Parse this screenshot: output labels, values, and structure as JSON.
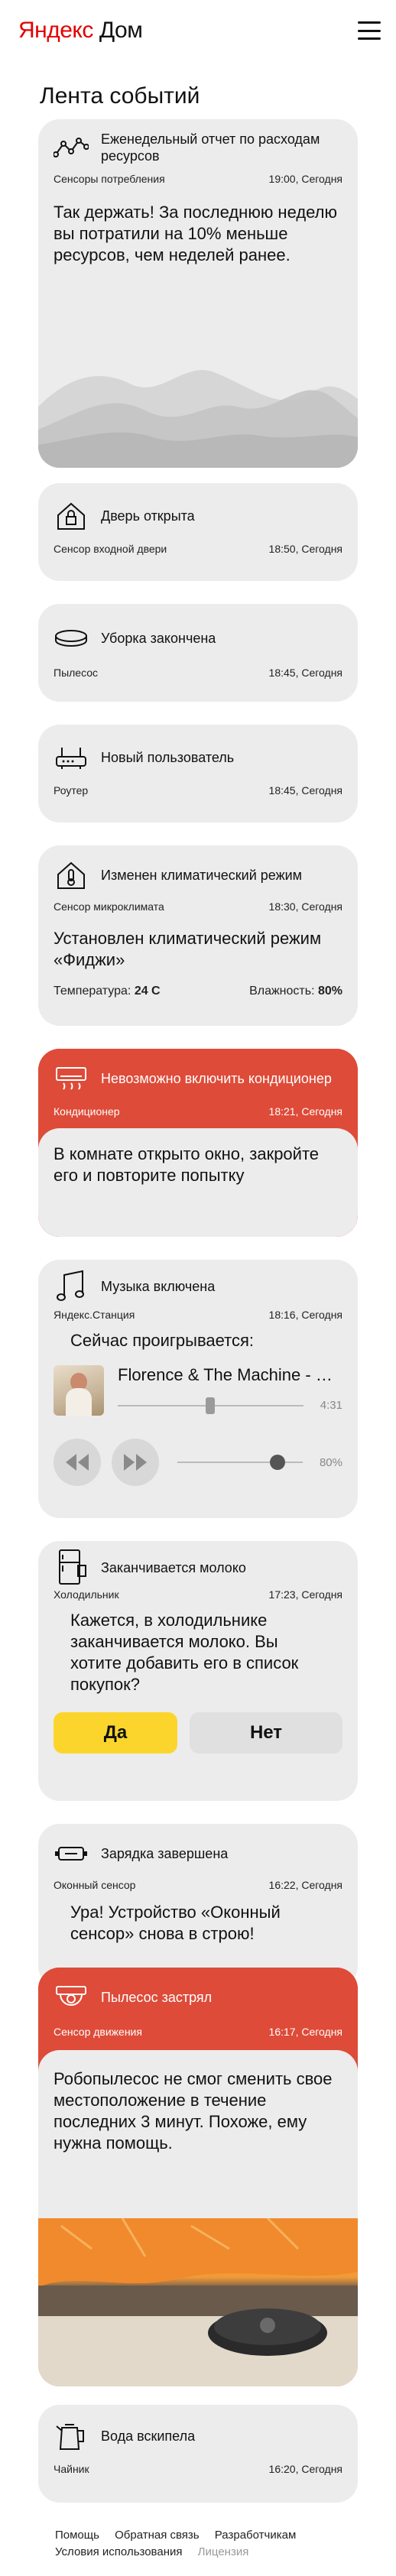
{
  "header": {
    "logo_brand": "Яндекс",
    "logo_product": "Дом"
  },
  "feed": {
    "title": "Лента событий"
  },
  "cards": {
    "report": {
      "title": "Еженедельный отчет по расходам ресурсов",
      "source": "Сенсоры потребления",
      "time": "19:00, Сегодня",
      "text": "Так держать! За последнюю неделю вы потратили на 10% меньше ресурсов, чем неделей ранее.",
      "icon": "chart-line-icon"
    },
    "door": {
      "title": "Дверь открыта",
      "source": "Сенсор входной двери",
      "time": "18:50, Сегодня",
      "icon": "house-lock-icon"
    },
    "cleaning": {
      "title": "Уборка закончена",
      "source": "Пылесос",
      "time": "18:45, Сегодня",
      "icon": "vacuum-icon"
    },
    "user": {
      "title": "Новый пользователь",
      "source": "Роутер",
      "time": "18:45, Сегодня",
      "icon": "router-icon"
    },
    "climate": {
      "title": "Изменен климатический режим",
      "source": "Сенсор микроклимата",
      "time": "18:30, Сегодня",
      "text": "Установлен климатический режим «Фиджи»",
      "temp_label": "Температура:",
      "temp_value": "24 C",
      "humidity_label": "Влажность:",
      "humidity_value": "80%",
      "icon": "house-thermometer-icon"
    },
    "ac": {
      "title": "Невозможно включить кондиционер",
      "source": "Кондиционер",
      "time": "18:21, Сегодня",
      "text": "В комнате открыто окно, закройте его и повторите попытку",
      "icon": "air-conditioner-icon"
    },
    "music": {
      "title": "Музыка включена",
      "source": "Яндекс.Станция",
      "time": "18:16, Сегодня",
      "now_playing": "Сейчас проигрывается:",
      "track": "Florence & The Machine - …",
      "duration": "4:31",
      "progress": 0.5,
      "volume_label": "80%",
      "volume": 0.8,
      "icon": "music-note-icon"
    },
    "milk": {
      "title": "Заканчивается молоко",
      "source": "Холодильник",
      "time": "17:23, Сегодня",
      "text": "Кажется, в холодильнике заканчивается молоко. Вы хотите добавить его в список покупок?",
      "yes": "Да",
      "no": "Нет",
      "icon": "fridge-icon"
    },
    "charge": {
      "title": "Зарядка завершена",
      "source": "Оконный сенсор",
      "time": "16:22, Сегодня",
      "text": "Ура! Устройство «Оконный сенсор» снова в строю!",
      "icon": "battery-icon"
    },
    "stuck": {
      "title": "Пылесос застрял",
      "source": "Сенсор движения",
      "time": "16:17, Сегодня",
      "text": "Робопылесос не смог сменить свое местоположение в течение последних 3 минут. Похоже, ему нужна помощь.",
      "icon": "camera-icon"
    },
    "kettle": {
      "title": "Вода вскипела",
      "source": "Чайник",
      "time": "16:20, Сегодня",
      "icon": "kettle-icon"
    }
  },
  "footer": {
    "links": [
      "Помощь",
      "Обратная связь",
      "Разработчикам",
      "Условия использования",
      "Лицензия"
    ]
  },
  "colors": {
    "alert": "#de4b39",
    "card": "#ececec",
    "accent_yellow": "#fcd52c",
    "brand_red": "#e30000"
  }
}
